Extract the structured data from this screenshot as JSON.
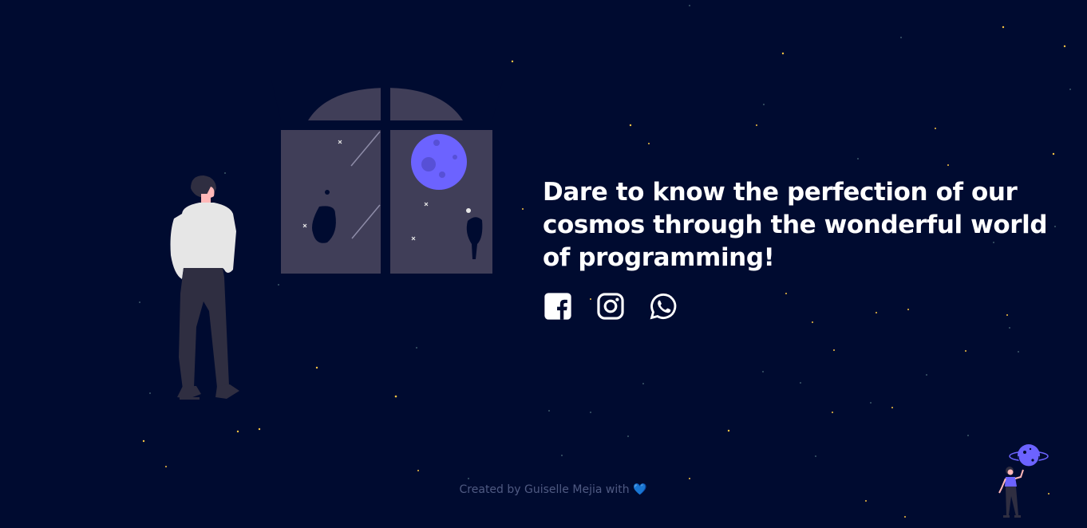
{
  "headline": "Dare to know the perfection of our cosmos through the wonderful world of programming!",
  "socials": [
    {
      "name": "Facebook",
      "icon": "facebook-icon"
    },
    {
      "name": "Instagram",
      "icon": "instagram-icon"
    },
    {
      "name": "WhatsApp",
      "icon": "whatsapp-icon"
    }
  ],
  "footer": {
    "text": "Created by Guiselle Mejia with",
    "heart": "💙"
  },
  "colors": {
    "background": "#000b30",
    "headline": "#ffffff",
    "footer_text": "#4f5a82",
    "planet": "#6c63ff",
    "window": "#3f3d56"
  }
}
